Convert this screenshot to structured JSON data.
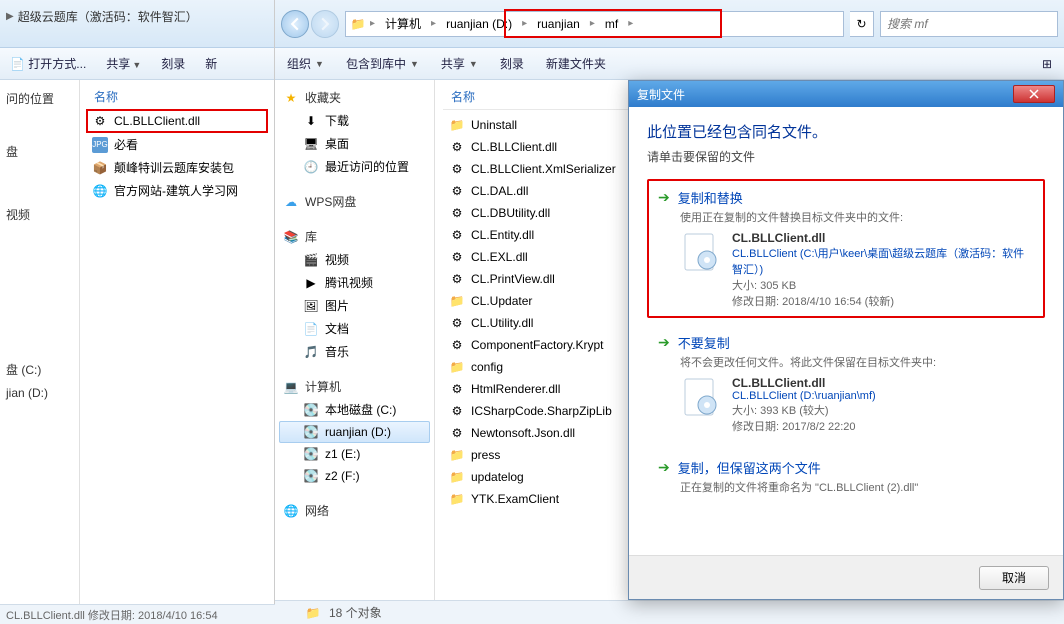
{
  "leftWindow": {
    "breadcrumb": "超级云题库（激活码：软件智汇）",
    "toolbar": {
      "open": "打开方式...",
      "share": "共享",
      "burn": "刻录",
      "new": "新"
    },
    "sidebar": {
      "recent": "问的位置",
      "disk": "盘",
      "video": "视频"
    },
    "header": "名称",
    "files": {
      "dll": "CL.BLLClient.dll",
      "jpg": "必看",
      "exe": "颠峰特训云题库安装包",
      "url": "官方网站-建筑人学习网"
    },
    "status": "CL.BLLClient.dll 修改日期: 2018/4/10 16:54"
  },
  "sidebarFoot": {
    "diskC": "盘 (C:)",
    "jianD": "jian (D:)"
  },
  "mainWindow": {
    "breadcrumb": {
      "computer": "计算机",
      "d": "ruanjian (D:)",
      "folder": "ruanjian",
      "sub": "mf"
    },
    "search_placeholder": "搜索 mf",
    "toolbar": {
      "organize": "组织",
      "include": "包含到库中",
      "share": "共享",
      "burn": "刻录",
      "newfolder": "新建文件夹"
    },
    "nav": {
      "fav": "收藏夹",
      "downloads": "下载",
      "desktop": "桌面",
      "recent": "最近访问的位置",
      "wps": "WPS网盘",
      "lib": "库",
      "video": "视频",
      "tencent": "腾讯视频",
      "pictures": "图片",
      "docs": "文档",
      "music": "音乐",
      "computer": "计算机",
      "diskC": "本地磁盘 (C:)",
      "diskD": "ruanjian (D:)",
      "diskE": "z1 (E:)",
      "diskF": "z2 (F:)",
      "network": "网络"
    },
    "header": "名称",
    "files": [
      "Uninstall",
      "CL.BLLClient.dll",
      "CL.BLLClient.XmlSerializer",
      "CL.DAL.dll",
      "CL.DBUtility.dll",
      "CL.Entity.dll",
      "CL.EXL.dll",
      "CL.PrintView.dll",
      "CL.Updater",
      "CL.Utility.dll",
      "ComponentFactory.Krypt",
      "config",
      "HtmlRenderer.dll",
      "ICSharpCode.SharpZipLib",
      "Newtonsoft.Json.dll",
      "press",
      "updatelog",
      "YTK.ExamClient"
    ],
    "status": "18 个对象"
  },
  "dialog": {
    "title": "复制文件",
    "heading": "此位置已经包含同名文件。",
    "sub": "请单击要保留的文件",
    "opt1": {
      "title": "复制和替换",
      "desc": "使用正在复制的文件替换目标文件夹中的文件:",
      "fname": "CL.BLLClient.dll",
      "fpath": "CL.BLLClient (C:\\用户\\keer\\桌面\\超级云题库（激活码：软件智汇）)",
      "size": "大小: 305 KB",
      "date": "修改日期: 2018/4/10 16:54 (较新)"
    },
    "opt2": {
      "title": "不要复制",
      "desc": "将不会更改任何文件。将此文件保留在目标文件夹中:",
      "fname": "CL.BLLClient.dll",
      "fpath": "CL.BLLClient (D:\\ruanjian\\mf)",
      "size": "大小: 393 KB (较大)",
      "date": "修改日期: 2017/8/2 22:20"
    },
    "opt3": {
      "title": "复制，但保留这两个文件",
      "desc": "正在复制的文件将重命名为 \"CL.BLLClient (2).dll\""
    },
    "cancel": "取消"
  }
}
